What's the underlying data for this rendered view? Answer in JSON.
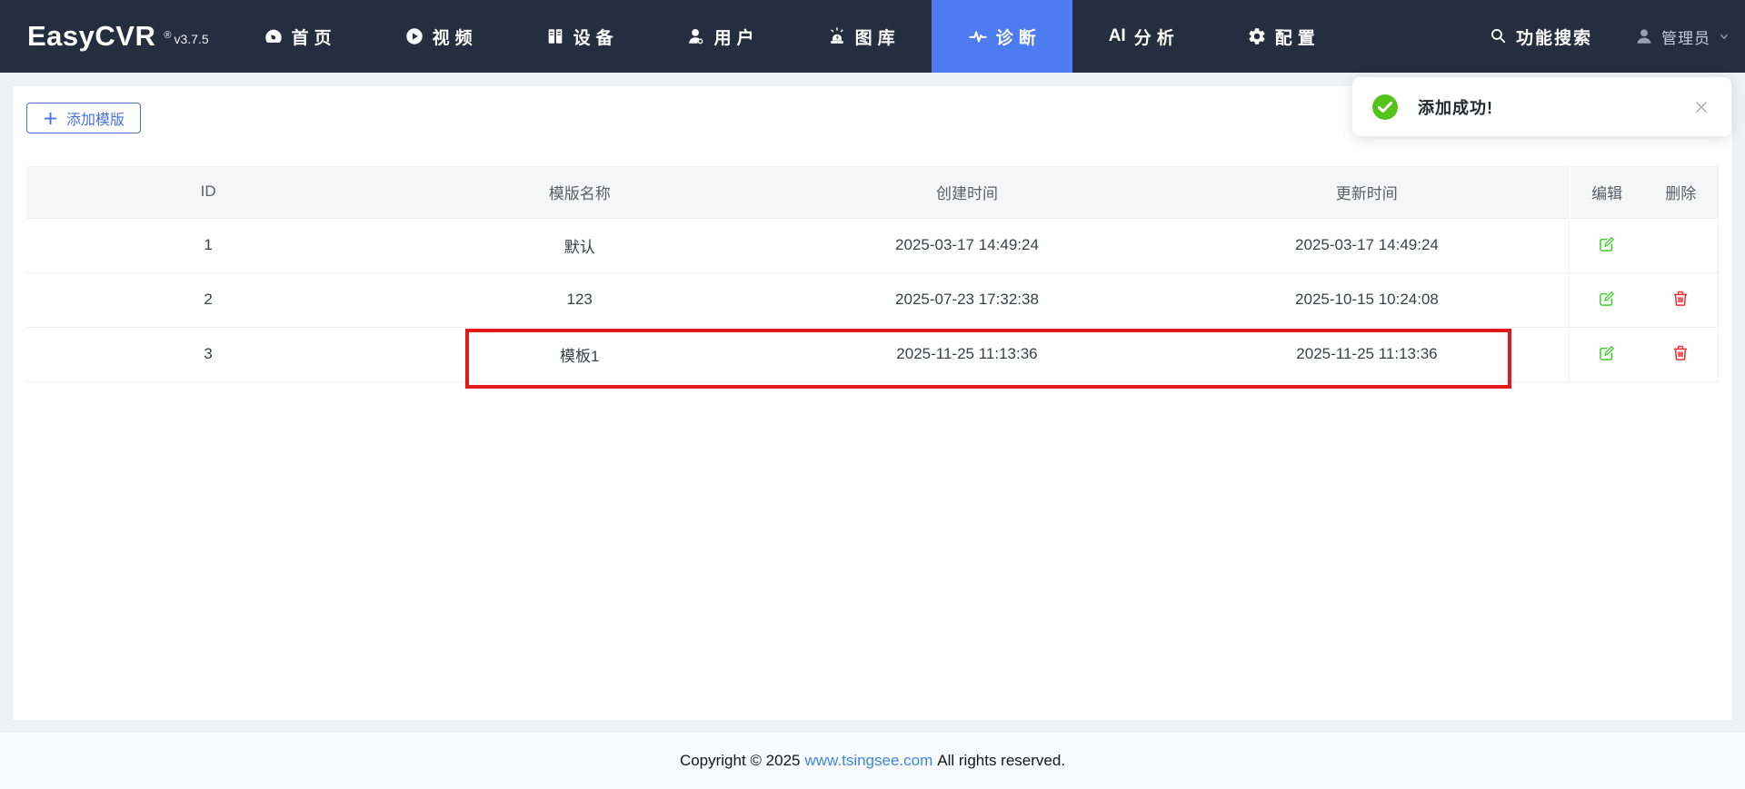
{
  "nav": {
    "logo": "EasyCVR",
    "registered_mark": "®",
    "version": "v3.7.5",
    "items": [
      {
        "label": "首页"
      },
      {
        "label": "视频"
      },
      {
        "label": "设备"
      },
      {
        "label": "用户"
      },
      {
        "label": "图库"
      },
      {
        "label": "诊断"
      },
      {
        "icon_text": "AI",
        "label": "分析"
      },
      {
        "label": "配置"
      }
    ],
    "search_label": "功能搜索",
    "user_label": "管理员"
  },
  "toolbar": {
    "add_template_label": "添加模版"
  },
  "toast": {
    "message": "添加成功!"
  },
  "table": {
    "headers": [
      "ID",
      "模版名称",
      "创建时间",
      "更新时间",
      "编辑",
      "删除"
    ],
    "rows": [
      {
        "id": "1",
        "name": "默认",
        "created": "2025-03-17 14:49:24",
        "updated": "2025-03-17 14:49:24"
      },
      {
        "id": "2",
        "name": "123",
        "created": "2025-07-23 17:32:38",
        "updated": "2025-10-15 10:24:08"
      },
      {
        "id": "3",
        "name": "模板1",
        "created": "2025-11-25 11:13:36",
        "updated": "2025-11-25 11:13:36"
      }
    ]
  },
  "footer": {
    "copyright_prefix": "Copyright © 2025",
    "link": "www.tsingsee.com",
    "copyright_suffix": "All rights reserved."
  },
  "colors": {
    "nav_bg": "#242e3e",
    "active_tab_blue": "#4d7bf0",
    "button_blue": "#4a71e8",
    "edit_green": "#3ecb28",
    "delete_red": "#f03030",
    "toast_green": "#52c41a",
    "highlight_red": "#e01a1a",
    "link_blue": "#3d87e0"
  }
}
